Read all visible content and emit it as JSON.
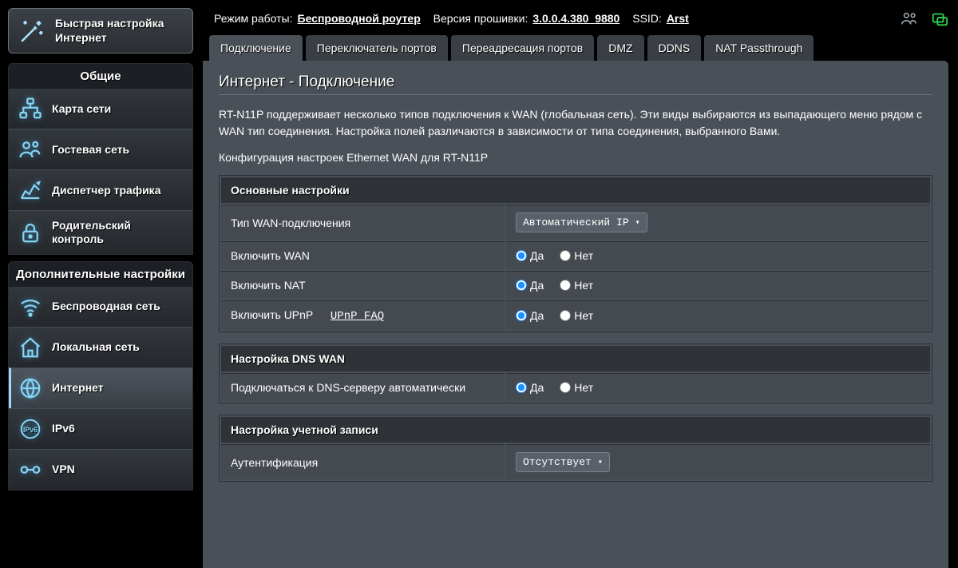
{
  "topbar": {
    "mode_label": "Режим работы:",
    "mode_value": "Беспроводной роутер",
    "fw_label": "Версия прошивки:",
    "fw_value": "3.0.0.4.380_9880",
    "ssid_label": "SSID:",
    "ssid_value": "Arst"
  },
  "qis_label": "Быстрая настройка Интернет",
  "sections": {
    "general": "Общие",
    "advanced": "Дополнительные настройки"
  },
  "menu_general": [
    {
      "label": "Карта сети"
    },
    {
      "label": "Гостевая сеть"
    },
    {
      "label": "Диспетчер трафика"
    },
    {
      "label": "Родительский контроль"
    }
  ],
  "menu_advanced": [
    {
      "label": "Беспроводная сеть"
    },
    {
      "label": "Локальная сеть"
    },
    {
      "label": "Интернет"
    },
    {
      "label": "IPv6"
    },
    {
      "label": "VPN"
    }
  ],
  "tabs": [
    "Подключение",
    "Переключатель портов",
    "Переадресация портов",
    "DMZ",
    "DDNS",
    "NAT Passthrough"
  ],
  "page": {
    "title": "Интернет - Подключение",
    "desc": "RT-N11P поддерживает несколько типов подключения к WAN (глобальная сеть). Эти виды выбираются из выпадающего меню рядом с WAN тип соединения. Настройка полей различаются в зависимости от типа соединения, выбранного Вами.",
    "subdesc": "Конфигурация настроек Ethernet WAN для RT-N11P"
  },
  "groups": {
    "basic": "Основные настройки",
    "dns": "Настройка DNS WAN",
    "account": "Настройка учетной записи"
  },
  "rows": {
    "wan_type_label": "Тип WAN-подключения",
    "wan_type_value": "Автоматический IP",
    "enable_wan": "Включить WAN",
    "enable_nat": "Включить NAT",
    "enable_upnp": "Включить UPnP",
    "upnp_faq": "UPnP FAQ",
    "dns_auto": "Подключаться к DNS-серверу автоматически",
    "auth_label": "Аутентификация",
    "auth_value": "Отсутствует"
  },
  "radio": {
    "yes": "Да",
    "no": "Нет"
  }
}
